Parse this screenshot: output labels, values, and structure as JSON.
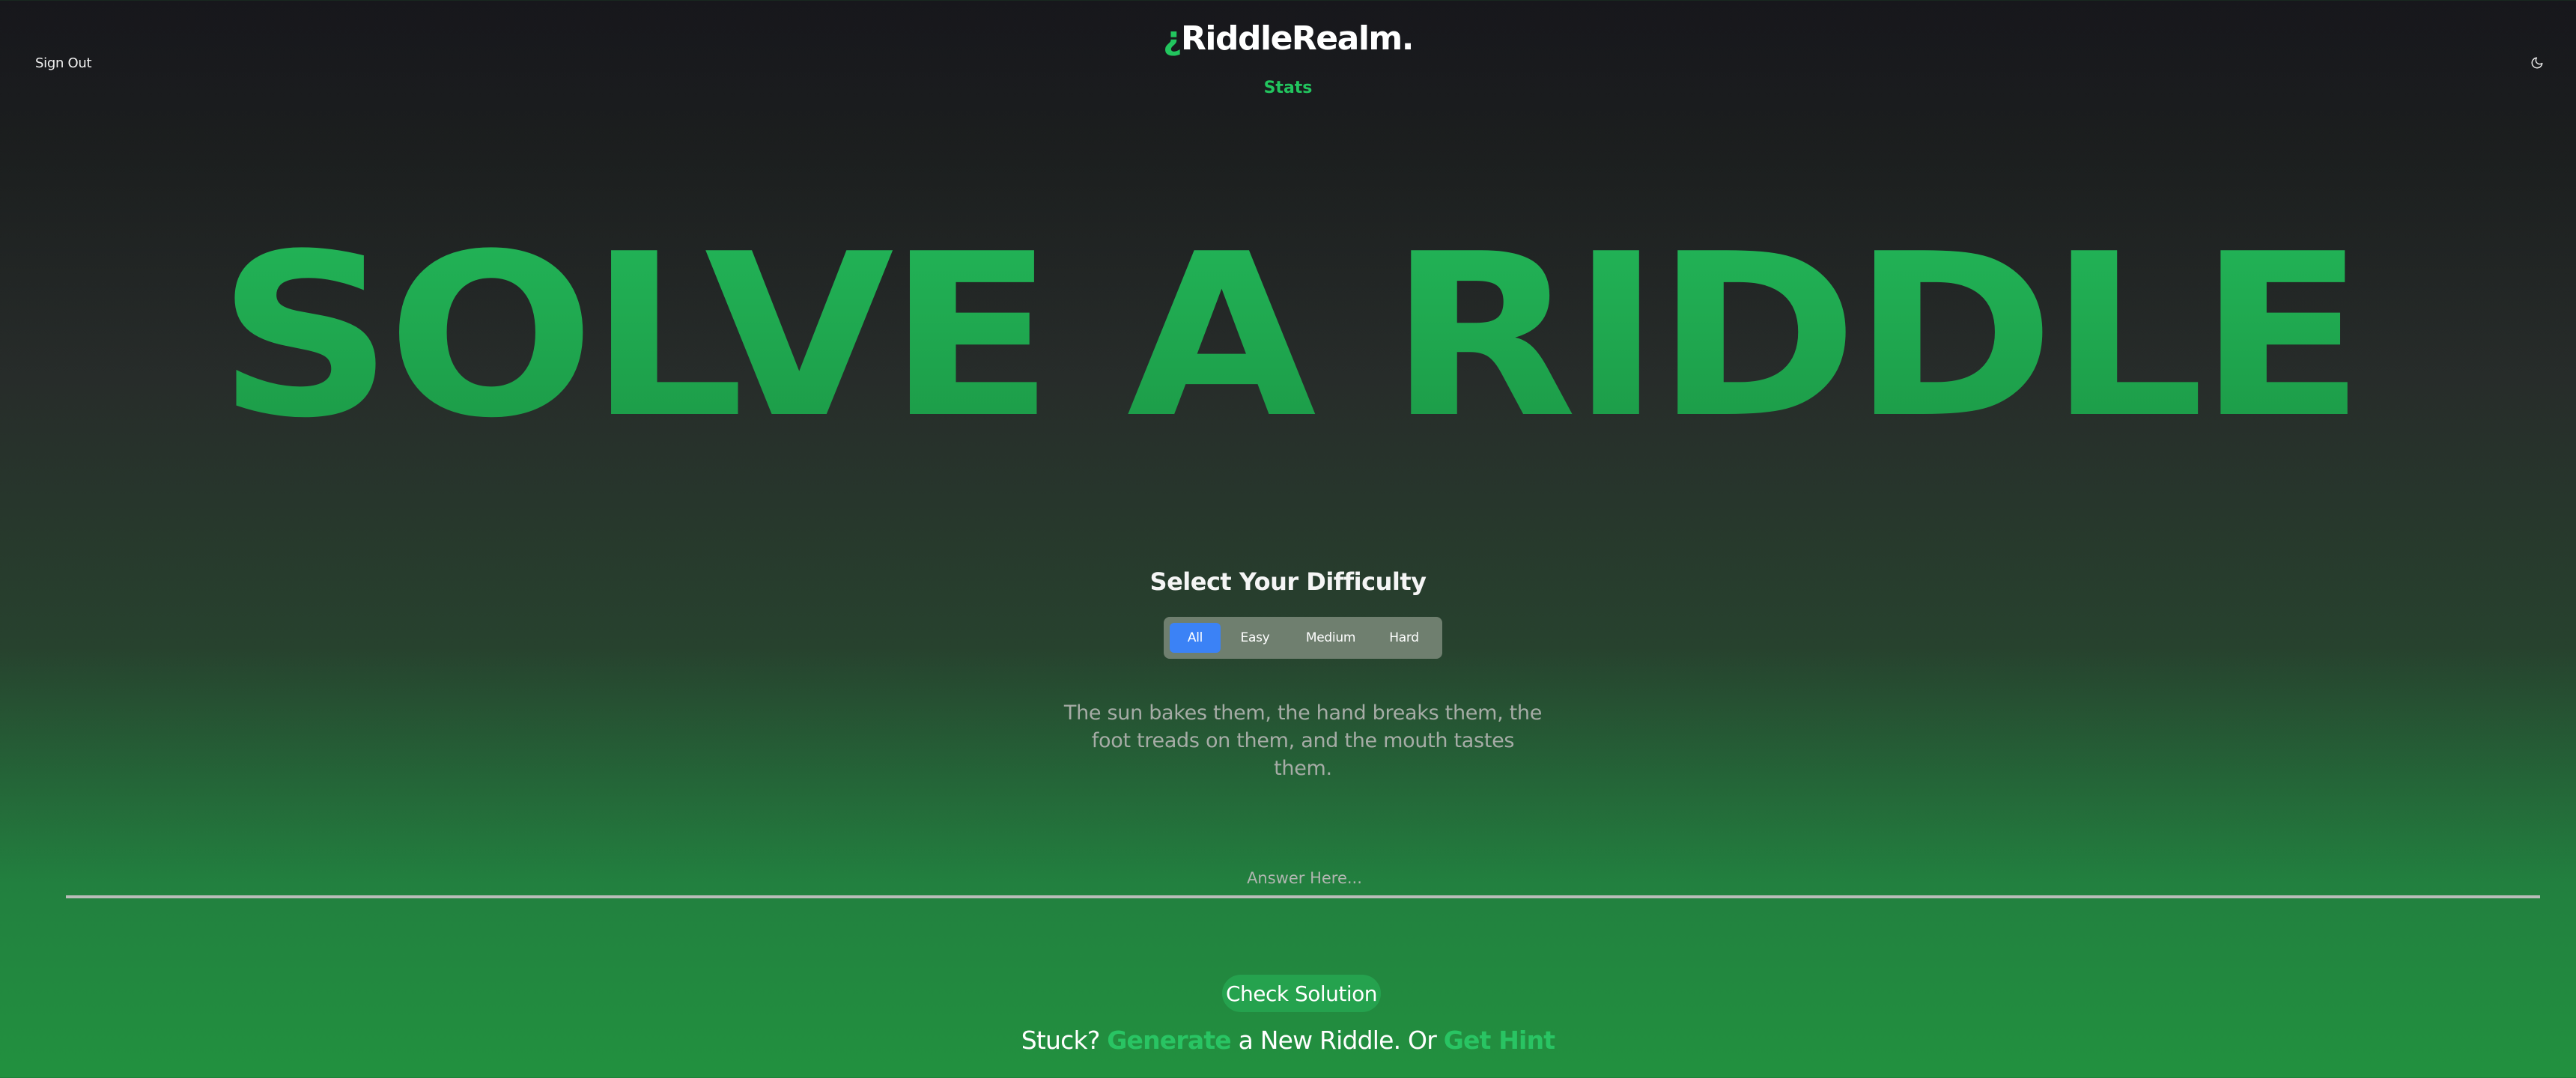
{
  "header": {
    "sign_out": "Sign Out",
    "logo_mark": "¿",
    "logo_text": "RiddleRealm.",
    "stats": "Stats",
    "theme_icon": "moon-icon"
  },
  "hero": {
    "title": "SOLVE A RIDDLE"
  },
  "difficulty": {
    "title": "Select Your Difficulty",
    "options": [
      "All",
      "Easy",
      "Medium",
      "Hard"
    ],
    "selected": "All"
  },
  "riddle": {
    "text": "The sun bakes them, the hand breaks them, the foot treads on them, and the mouth tastes them."
  },
  "answer": {
    "placeholder": "Answer Here...",
    "value": ""
  },
  "actions": {
    "check": "Check Solution",
    "stuck_prefix": "Stuck?",
    "generate": "Generate",
    "stuck_middle": "a New Riddle.",
    "or": "Or",
    "hint": "Get Hint"
  },
  "colors": {
    "accent": "#22c55e",
    "selected_pill": "#3b82f6",
    "pill_group": "#6f7f6f"
  }
}
